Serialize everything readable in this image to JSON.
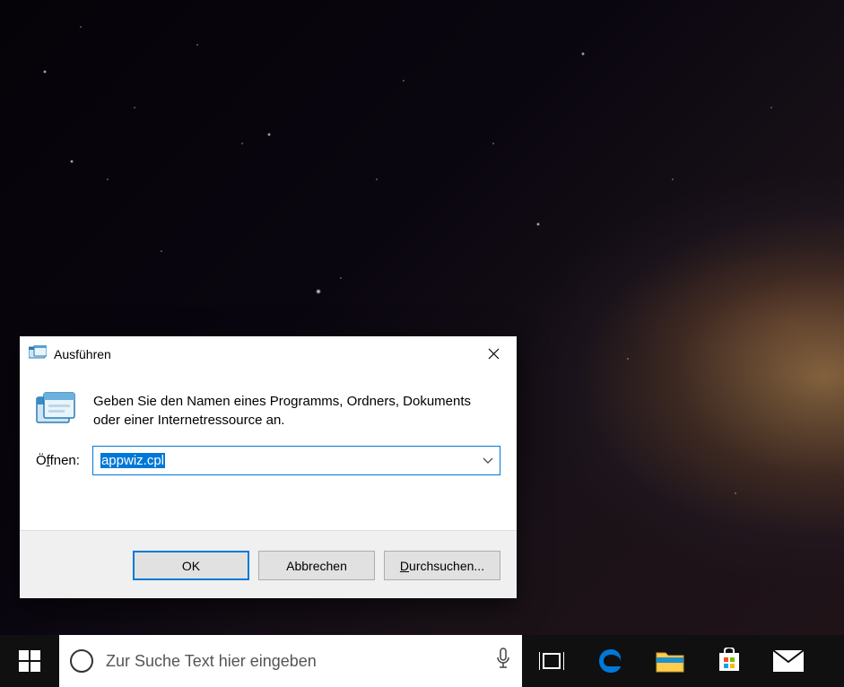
{
  "dialog": {
    "title": "Ausführen",
    "description": "Geben Sie den Namen eines Programms, Ordners, Dokuments oder einer Internetressource an.",
    "open_label_pre": "Ö",
    "open_label_u": "f",
    "open_label_post": "fnen:",
    "input_value": "appwiz.cpl",
    "ok_label": "OK",
    "cancel_label": "Abbrechen",
    "browse_label_u": "D",
    "browse_label_post": "urchsuchen..."
  },
  "taskbar": {
    "search_placeholder": "Zur Suche Text hier eingeben"
  }
}
